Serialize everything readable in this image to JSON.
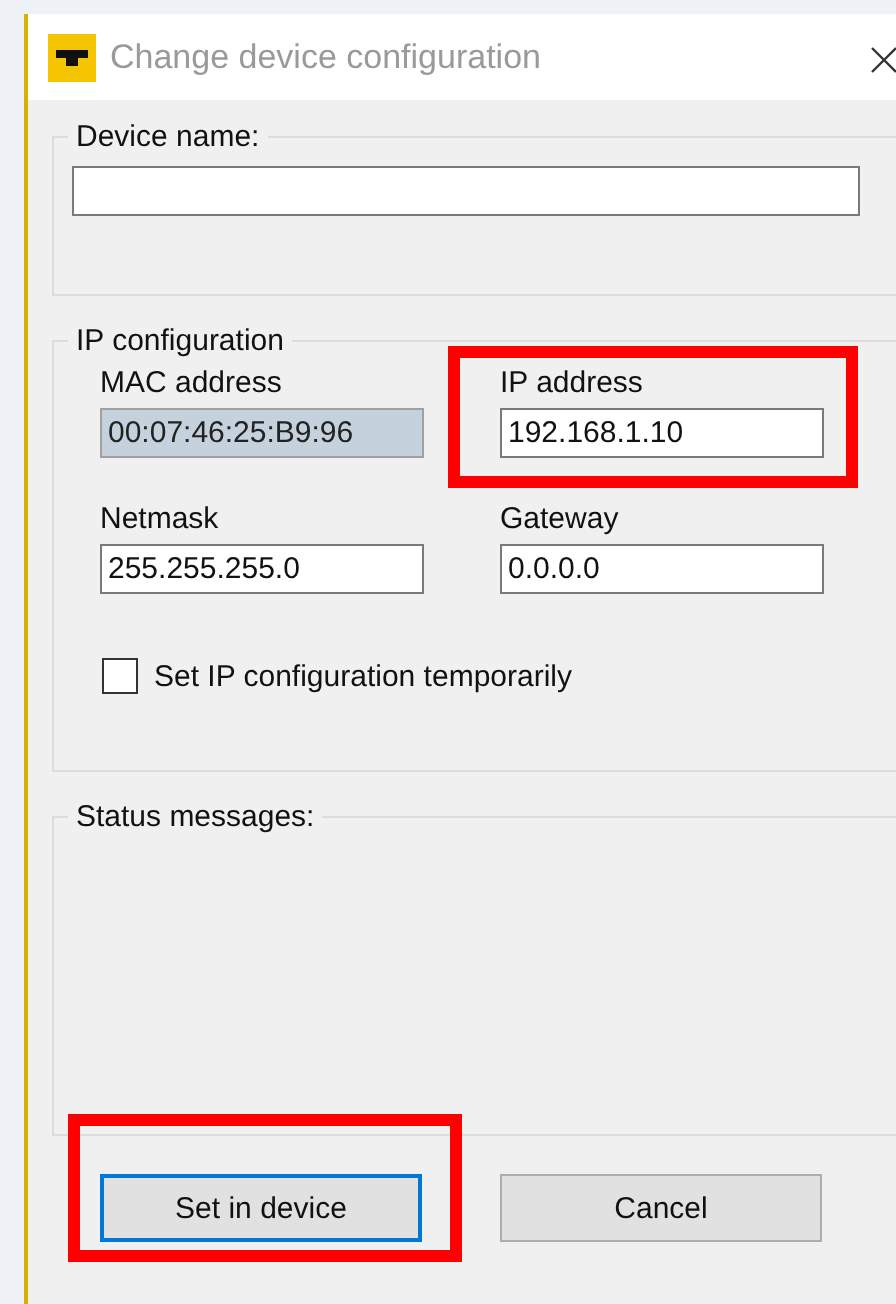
{
  "window": {
    "title": "Change device configuration"
  },
  "device_name": {
    "label": "Device name:"
  },
  "ip_configuration": {
    "title": "IP configuration",
    "fields": [
      {
        "label": "MAC address",
        "value": "00:07:46:25:B9:96",
        "disabled": true,
        "highlighted": false
      },
      {
        "label": "IP address",
        "value": "192.168.1.10",
        "disabled": false,
        "highlighted": true
      },
      {
        "label": "Netmask",
        "value": "255.255.255.0",
        "disabled": false,
        "highlighted": false
      },
      {
        "label": "Gateway",
        "value": "0.0.0.0",
        "disabled": false,
        "highlighted": false
      }
    ],
    "temporary": {
      "label": "Set IP configuration temporarily",
      "checked": false
    }
  },
  "status_messages": {
    "title": "Status messages:"
  },
  "buttons": [
    {
      "label": "Set in device",
      "default": true,
      "highlighted": true
    },
    {
      "label": "Cancel",
      "default": false,
      "highlighted": false
    }
  ]
}
